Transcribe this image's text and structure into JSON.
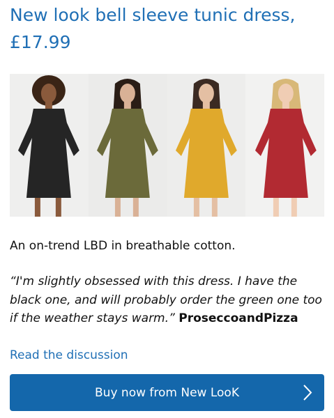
{
  "article": {
    "title": "New look bell sleeve tunic dress, £17.99",
    "description": "An on-trend LBD in breathable cotton.",
    "quote": {
      "text": "“I'm slightly obsessed with this dress. I have the black one, and will probably order the green one too if the weather stays warm.”",
      "author": "ProseccoandPizza"
    },
    "discussion_link": "Read the discussion",
    "buy_button": "Buy now from New LooK"
  },
  "image": {
    "variants": [
      {
        "name": "black",
        "dress_color": "#252525",
        "hair_color": "#3a2416",
        "skin_color": "#8a5a3c"
      },
      {
        "name": "khaki",
        "dress_color": "#6b6a3a",
        "hair_color": "#2a1d16",
        "skin_color": "#d9b196"
      },
      {
        "name": "mustard",
        "dress_color": "#e0a92c",
        "hair_color": "#3b2a22",
        "skin_color": "#e4bfa3"
      },
      {
        "name": "red",
        "dress_color": "#b22a32",
        "hair_color": "#d8b878",
        "skin_color": "#f0cdb4"
      }
    ]
  },
  "colors": {
    "accent": "#1f6fb5",
    "button": "#1467ab"
  }
}
